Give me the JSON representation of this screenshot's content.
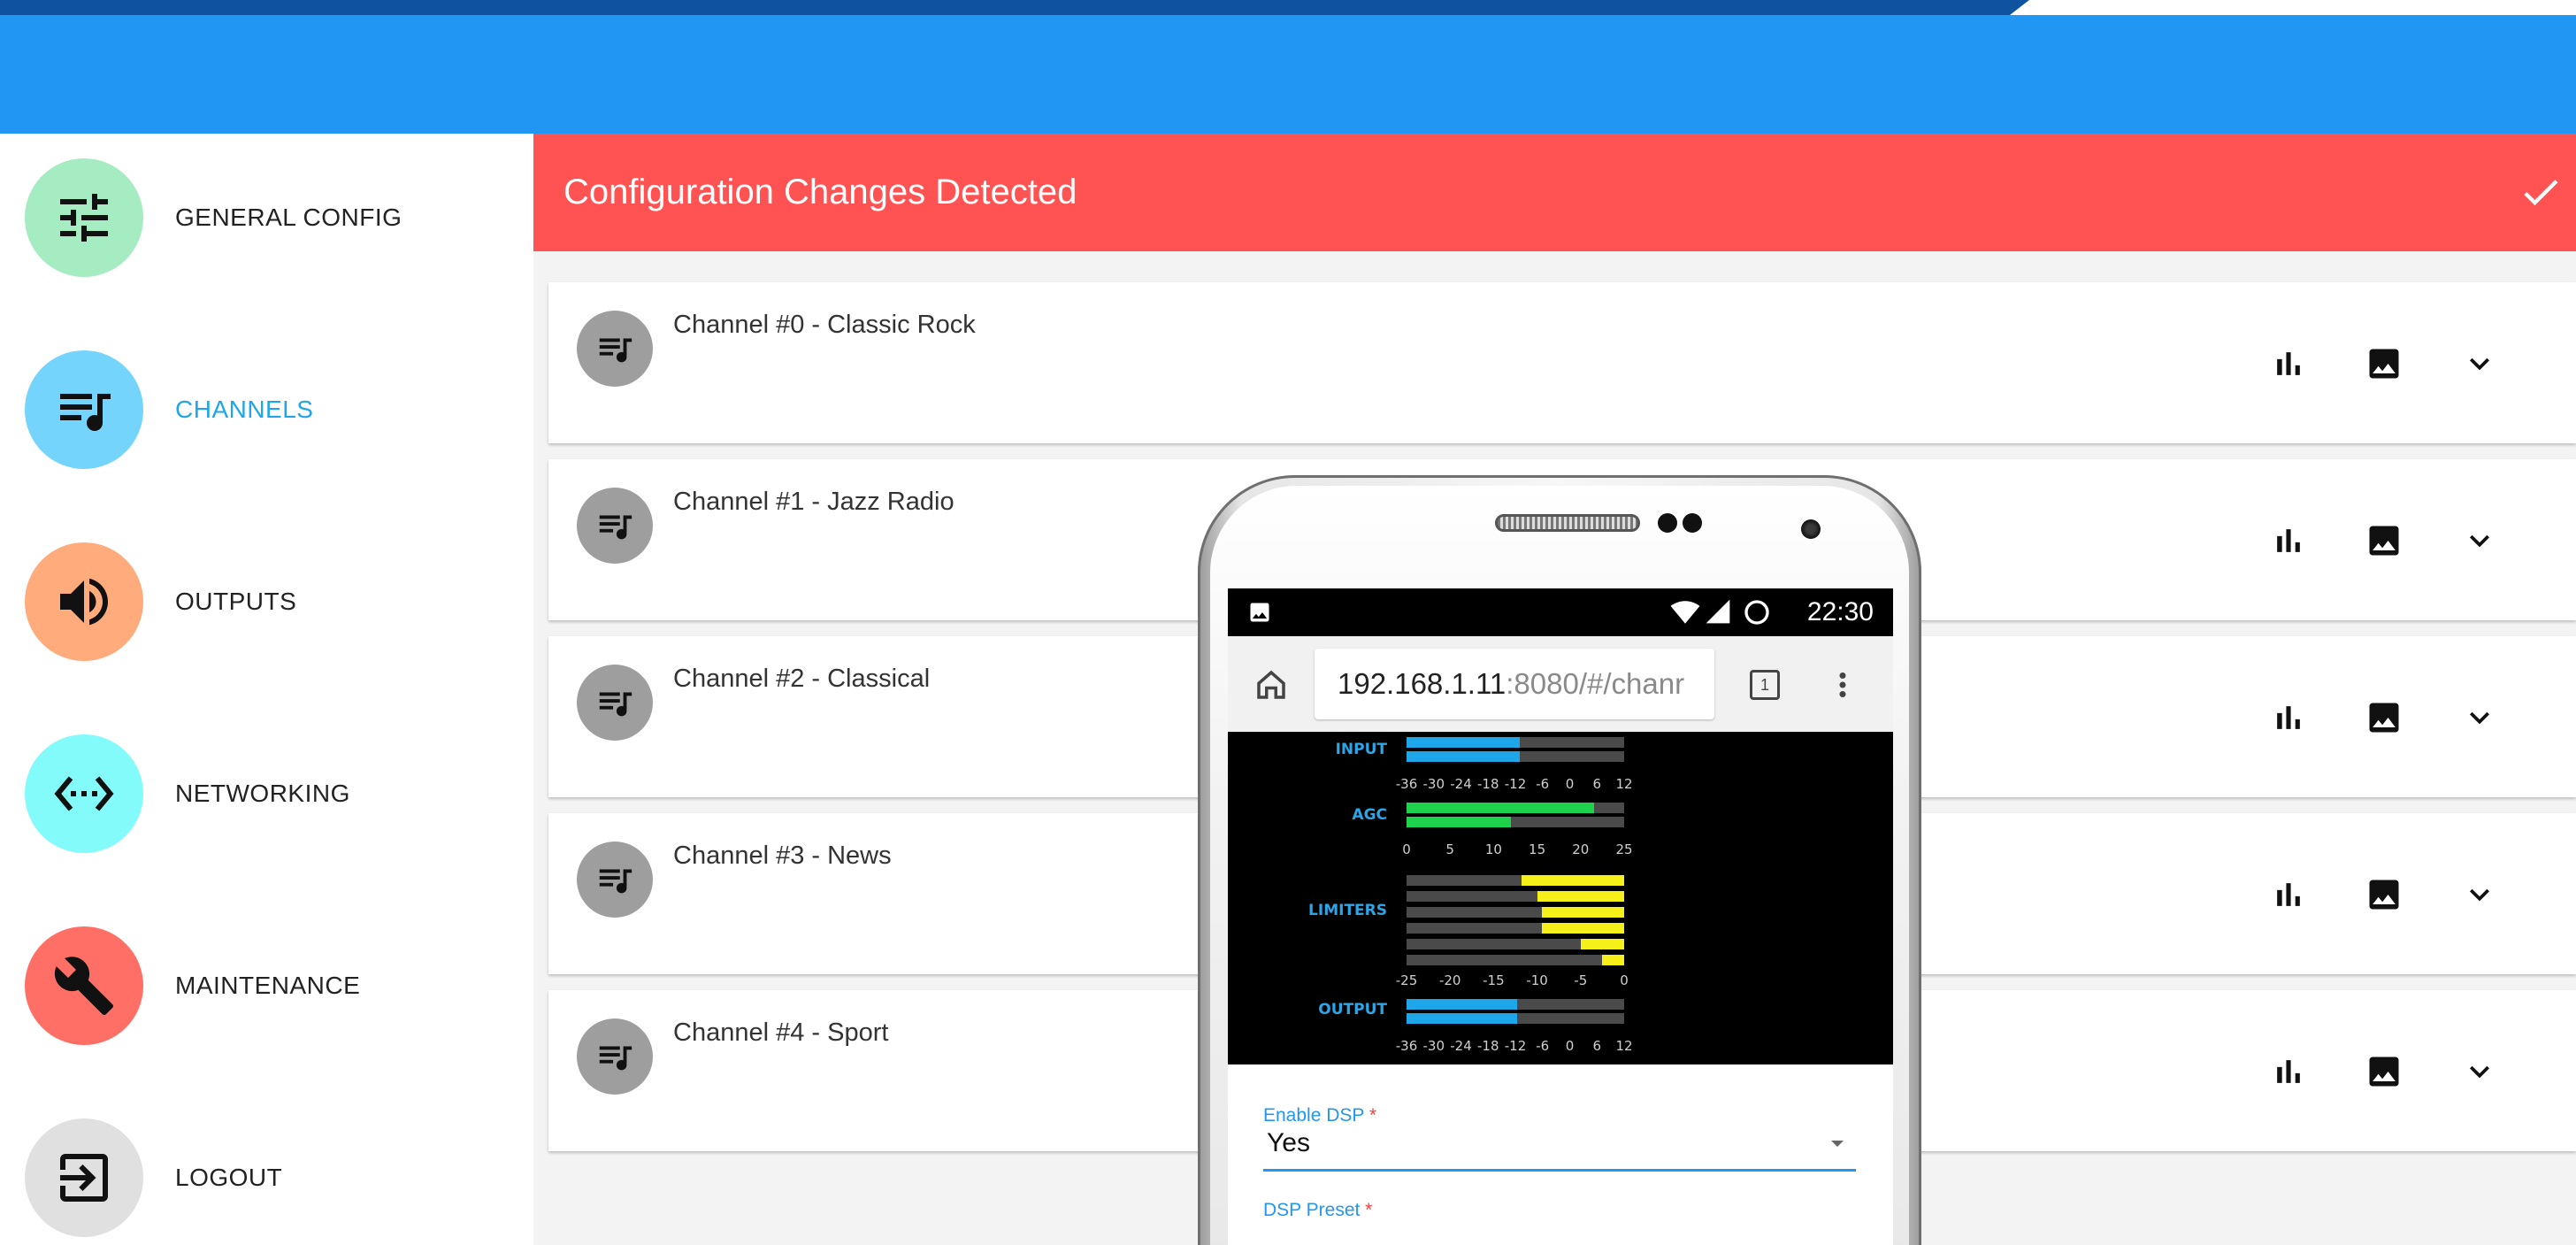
{
  "sidebar": {
    "items": [
      {
        "label": "GENERAL CONFIG",
        "icon": "tune-icon",
        "color": "#a6ecc2",
        "active": false
      },
      {
        "label": "CHANNELS",
        "icon": "queue-music-icon",
        "color": "#74d4fb",
        "active": true
      },
      {
        "label": "OUTPUTS",
        "icon": "volume-up-icon",
        "color": "#ffab7b",
        "active": false
      },
      {
        "label": "NETWORKING",
        "icon": "settings-ethernet-icon",
        "color": "#84fbfb",
        "active": false
      },
      {
        "label": "MAINTENANCE",
        "icon": "build-icon",
        "color": "#ff6f65",
        "active": false
      },
      {
        "label": "LOGOUT",
        "icon": "exit-to-app-icon",
        "color": "#e0e0e0",
        "active": false
      }
    ]
  },
  "banner": {
    "text": "Configuration Changes Detected",
    "color": "#ff5252",
    "icon": "check-icon"
  },
  "channels": [
    {
      "title": "Channel #0 - Classic Rock"
    },
    {
      "title": "Channel #1 - Jazz Radio"
    },
    {
      "title": "Channel #2 - Classical"
    },
    {
      "title": "Channel #3 - News"
    },
    {
      "title": "Channel #4 - Sport"
    }
  ],
  "channel_actions": [
    "bar-chart-icon",
    "image-icon",
    "expand-more-icon"
  ],
  "phone": {
    "status_time": "22:30",
    "url_host": "192.168.1.11",
    "url_path": ":8080/#/chanr",
    "tab_count": "1",
    "dsp_meters": {
      "input_label": "INPUT",
      "agc_label": "AGC",
      "limiters_label": "LIMITERS",
      "output_label": "OUTPUT",
      "db_scale": [
        "-36",
        "-30",
        "-24",
        "-18",
        "-12",
        "-6",
        "0",
        "6",
        "12"
      ],
      "agc_scale": [
        "0",
        "5",
        "10",
        "15",
        "20",
        "25"
      ],
      "limiter_scale": [
        "-25",
        "-20",
        "-15",
        "-10",
        "-5",
        "0"
      ],
      "input_levels": [
        0.52,
        0.52
      ],
      "agc_levels": [
        0.86,
        0.48
      ],
      "limiter_levels": [
        0.47,
        0.4,
        0.38,
        0.38,
        0.2,
        0.1
      ],
      "output_levels": [
        0.51,
        0.51
      ]
    },
    "form": {
      "enable_dsp_label": "Enable DSP",
      "enable_dsp_value": "Yes",
      "dsp_preset_label": "DSP Preset",
      "required_mark": "*"
    }
  },
  "colors": {
    "app_bar": "#2196f3",
    "top_strip": "#0d53a0",
    "accent_active": "#1ea7e8",
    "meter_blue": "#1ea7e8",
    "meter_green": "#1ed34b",
    "meter_yellow": "#f5f019"
  }
}
